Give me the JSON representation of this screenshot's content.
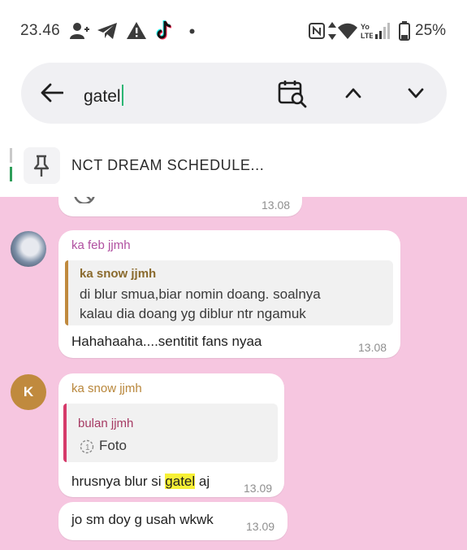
{
  "status_bar": {
    "time": "23.46",
    "battery": "25%",
    "icons": [
      "person-add-icon",
      "telegram-icon",
      "warning-icon",
      "tiktok-icon",
      "dot-icon",
      "nfc-icon",
      "data-arrows-icon",
      "wifi-icon",
      "volte-icon",
      "signal-icon",
      "battery-icon"
    ]
  },
  "search": {
    "query": "gatel",
    "icons": [
      "back-arrow-icon",
      "calendar-search-icon",
      "chevron-up-icon",
      "chevron-down-icon"
    ]
  },
  "pinned": {
    "title": "NCT DREAM SCHEDULE..."
  },
  "chat": {
    "background": "#f6c6e0",
    "top_partial": {
      "time": "13.08"
    },
    "messages": [
      {
        "sender": "ka feb jjmh",
        "sender_color": "#b04fa0",
        "reply_to": {
          "name": "ka snow jjmh",
          "name_color": "#8a6a2d",
          "bar_color": "#c08a3e",
          "text_line1": "di blur smua,biar nomin doang. soalnya",
          "text_line2": "kalau dia doang yg diblur ntr ngamuk"
        },
        "text": "Hahahaaha....sentitit fans nyaa",
        "time": "13.08"
      },
      {
        "sender": "ka snow jjmh",
        "sender_color": "#b8863a",
        "avatar_letter": "K",
        "avatar_color": "#c08a3e",
        "reply_to": {
          "name": "bulan jjmh",
          "name_color": "#a63a63",
          "bar_color": "#d63a6a",
          "media": "Foto"
        },
        "text_before": "hrusnya blur si ",
        "text_highlight": "gatel",
        "text_after": " aj",
        "time": "13.09"
      },
      {
        "text": "jo sm doy g usah wkwk",
        "time": "13.09"
      }
    ]
  }
}
